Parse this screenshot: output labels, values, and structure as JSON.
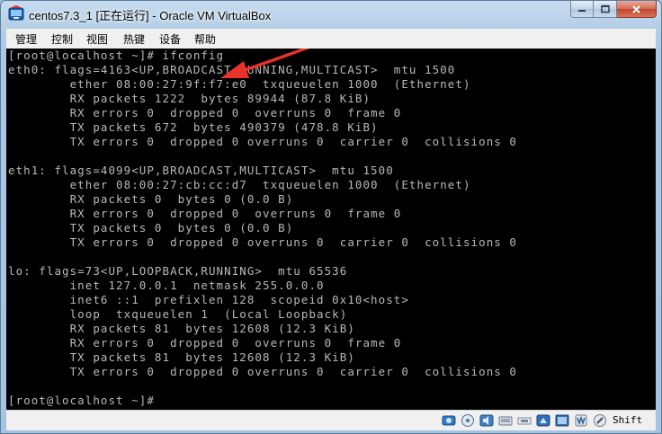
{
  "window": {
    "title": "centos7.3_1 [正在运行] - Oracle VM VirtualBox",
    "icon": "virtualbox-icon"
  },
  "menu": [
    {
      "label": "管理"
    },
    {
      "label": "控制"
    },
    {
      "label": "视图"
    },
    {
      "label": "热键"
    },
    {
      "label": "设备"
    },
    {
      "label": "帮助"
    }
  ],
  "terminal": {
    "lines": [
      "[root@localhost ~]# ifconfig",
      "eth0: flags=4163<UP,BROADCAST,RUNNING,MULTICAST>  mtu 1500",
      "        ether 08:00:27:9f:f7:e0  txqueuelen 1000  (Ethernet)",
      "        RX packets 1222  bytes 89944 (87.8 KiB)",
      "        RX errors 0  dropped 0  overruns 0  frame 0",
      "        TX packets 672  bytes 490379 (478.8 KiB)",
      "        TX errors 0  dropped 0 overruns 0  carrier 0  collisions 0",
      "",
      "eth1: flags=4099<UP,BROADCAST,MULTICAST>  mtu 1500",
      "        ether 08:00:27:cb:cc:d7  txqueuelen 1000  (Ethernet)",
      "        RX packets 0  bytes 0 (0.0 B)",
      "        RX errors 0  dropped 0  overruns 0  frame 0",
      "        TX packets 0  bytes 0 (0.0 B)",
      "        TX errors 0  dropped 0 overruns 0  carrier 0  collisions 0",
      "",
      "lo: flags=73<UP,LOOPBACK,RUNNING>  mtu 65536",
      "        inet 127.0.0.1  netmask 255.0.0.0",
      "        inet6 ::1  prefixlen 128  scopeid 0x10<host>",
      "        loop  txqueuelen 1  (Local Loopback)",
      "        RX packets 81  bytes 12608 (12.3 KiB)",
      "        RX errors 0  dropped 0  overruns 0  frame 0",
      "        TX packets 81  bytes 12608 (12.3 KiB)",
      "        TX errors 0  dropped 0 overruns 0  carrier 0  collisions 0",
      "",
      "[root@localhost ~]#"
    ],
    "text_color": "#b8b8b8",
    "background": "#000000",
    "annotation": {
      "type": "arrow",
      "color": "#e8322a"
    }
  },
  "statusbar": {
    "icons": [
      "hard-disk-icon",
      "optical-drive-icon",
      "audio-icon",
      "network-icon",
      "usb-icon",
      "shared-folders-icon",
      "display-icon",
      "video-capture-icon",
      "cpu-icon",
      "mouse-integration-icon"
    ],
    "host_key": "Shift"
  }
}
